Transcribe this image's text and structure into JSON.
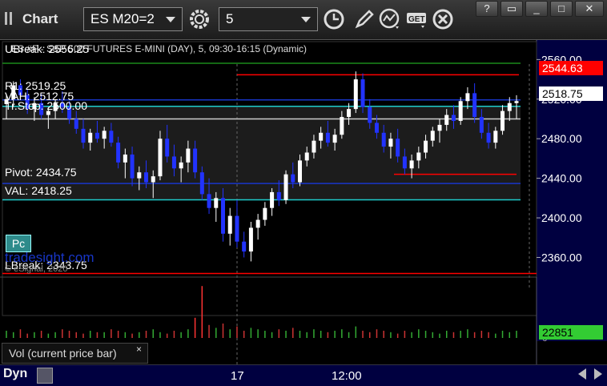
{
  "app": {
    "title": "Chart"
  },
  "toolbar": {
    "symbol": "ES M20=2",
    "interval": "5",
    "settings_icon": "gear-icon",
    "clock_icon": "clock-icon",
    "pen_icon": "pen-icon",
    "studies_icon": "studies-icon",
    "get_icon": "get-icon",
    "close_icon": "close-icon"
  },
  "window_buttons": [
    "?",
    "▭",
    "_",
    "□",
    "✕"
  ],
  "chart": {
    "header": "ES #F - S&P 500 FUTURES E-MINI (DAY), 5, 09:30-16:15 (Dynamic)",
    "levels": {
      "ubreak": "UBreak: 2556.25",
      "r1": "R1: 2519.25",
      "vah": "VAH: 2512.75",
      "trstop": "Tr.Stop: 2500.00",
      "pivot": "Pivot: 2434.75",
      "val": "VAL: 2418.25",
      "lbreak": "LBreak: 2343.75"
    },
    "pc_button": "Pc",
    "watermark": "tradesight.com",
    "copyright": "© eSignal, 2020",
    "price_axis": [
      "2560.00",
      "2520.00",
      "2480.00",
      "2440.00",
      "2400.00",
      "2360.00"
    ],
    "price_tags": {
      "red": "2544.63",
      "last": "2518.75"
    },
    "colors": {
      "up": "#ffffff",
      "down": "#2233ff",
      "ubreak": "#1a8a1a",
      "pivot": "#1836c8",
      "val": "#1ecbcb",
      "red": "#ff0000",
      "axis_bg": "#000040"
    }
  },
  "volume": {
    "label": "Vol (current price bar)",
    "close": "×",
    "value": "22851",
    "zero": "0"
  },
  "time_axis": {
    "labels": [
      "17",
      "12:00"
    ]
  },
  "footer": {
    "dyn": "Dyn"
  },
  "chart_data": {
    "type": "candlestick",
    "ylabel": "",
    "ylim": [
      2345,
      2570
    ],
    "series": [
      {
        "o": 2515,
        "h": 2525,
        "l": 2500,
        "c": 2520
      },
      {
        "o": 2520,
        "h": 2538,
        "l": 2512,
        "c": 2534
      },
      {
        "o": 2534,
        "h": 2540,
        "l": 2520,
        "c": 2524
      },
      {
        "o": 2524,
        "h": 2530,
        "l": 2505,
        "c": 2510
      },
      {
        "o": 2510,
        "h": 2522,
        "l": 2498,
        "c": 2516
      },
      {
        "o": 2516,
        "h": 2525,
        "l": 2500,
        "c": 2504
      },
      {
        "o": 2504,
        "h": 2512,
        "l": 2490,
        "c": 2508
      },
      {
        "o": 2508,
        "h": 2520,
        "l": 2500,
        "c": 2516
      },
      {
        "o": 2516,
        "h": 2528,
        "l": 2506,
        "c": 2512
      },
      {
        "o": 2512,
        "h": 2518,
        "l": 2495,
        "c": 2500
      },
      {
        "o": 2500,
        "h": 2508,
        "l": 2485,
        "c": 2490
      },
      {
        "o": 2490,
        "h": 2500,
        "l": 2470,
        "c": 2476
      },
      {
        "o": 2476,
        "h": 2490,
        "l": 2468,
        "c": 2486
      },
      {
        "o": 2486,
        "h": 2498,
        "l": 2476,
        "c": 2480
      },
      {
        "o": 2480,
        "h": 2492,
        "l": 2470,
        "c": 2488
      },
      {
        "o": 2488,
        "h": 2496,
        "l": 2472,
        "c": 2476
      },
      {
        "o": 2476,
        "h": 2482,
        "l": 2450,
        "c": 2456
      },
      {
        "o": 2456,
        "h": 2470,
        "l": 2440,
        "c": 2464
      },
      {
        "o": 2464,
        "h": 2472,
        "l": 2432,
        "c": 2440
      },
      {
        "o": 2440,
        "h": 2452,
        "l": 2428,
        "c": 2446
      },
      {
        "o": 2446,
        "h": 2458,
        "l": 2430,
        "c": 2436
      },
      {
        "o": 2436,
        "h": 2448,
        "l": 2420,
        "c": 2442
      },
      {
        "o": 2442,
        "h": 2488,
        "l": 2438,
        "c": 2480
      },
      {
        "o": 2480,
        "h": 2494,
        "l": 2456,
        "c": 2462
      },
      {
        "o": 2462,
        "h": 2474,
        "l": 2442,
        "c": 2450
      },
      {
        "o": 2450,
        "h": 2462,
        "l": 2436,
        "c": 2456
      },
      {
        "o": 2456,
        "h": 2478,
        "l": 2446,
        "c": 2470
      },
      {
        "o": 2470,
        "h": 2478,
        "l": 2440,
        "c": 2446
      },
      {
        "o": 2446,
        "h": 2452,
        "l": 2418,
        "c": 2424
      },
      {
        "o": 2424,
        "h": 2440,
        "l": 2404,
        "c": 2410
      },
      {
        "o": 2410,
        "h": 2426,
        "l": 2396,
        "c": 2420
      },
      {
        "o": 2420,
        "h": 2430,
        "l": 2376,
        "c": 2384
      },
      {
        "o": 2384,
        "h": 2410,
        "l": 2372,
        "c": 2402
      },
      {
        "o": 2402,
        "h": 2418,
        "l": 2370,
        "c": 2376
      },
      {
        "o": 2376,
        "h": 2386,
        "l": 2360,
        "c": 2366
      },
      {
        "o": 2366,
        "h": 2396,
        "l": 2356,
        "c": 2390
      },
      {
        "o": 2390,
        "h": 2404,
        "l": 2378,
        "c": 2398
      },
      {
        "o": 2398,
        "h": 2416,
        "l": 2392,
        "c": 2410
      },
      {
        "o": 2410,
        "h": 2430,
        "l": 2402,
        "c": 2426
      },
      {
        "o": 2426,
        "h": 2438,
        "l": 2412,
        "c": 2418
      },
      {
        "o": 2418,
        "h": 2448,
        "l": 2414,
        "c": 2444
      },
      {
        "o": 2444,
        "h": 2456,
        "l": 2430,
        "c": 2436
      },
      {
        "o": 2436,
        "h": 2464,
        "l": 2432,
        "c": 2458
      },
      {
        "o": 2458,
        "h": 2472,
        "l": 2452,
        "c": 2466
      },
      {
        "o": 2466,
        "h": 2484,
        "l": 2460,
        "c": 2478
      },
      {
        "o": 2478,
        "h": 2492,
        "l": 2470,
        "c": 2486
      },
      {
        "o": 2486,
        "h": 2498,
        "l": 2472,
        "c": 2476
      },
      {
        "o": 2476,
        "h": 2490,
        "l": 2468,
        "c": 2484
      },
      {
        "o": 2484,
        "h": 2508,
        "l": 2480,
        "c": 2502
      },
      {
        "o": 2502,
        "h": 2516,
        "l": 2494,
        "c": 2510
      },
      {
        "o": 2510,
        "h": 2548,
        "l": 2506,
        "c": 2540
      },
      {
        "o": 2540,
        "h": 2546,
        "l": 2506,
        "c": 2512
      },
      {
        "o": 2512,
        "h": 2520,
        "l": 2490,
        "c": 2496
      },
      {
        "o": 2496,
        "h": 2504,
        "l": 2480,
        "c": 2486
      },
      {
        "o": 2486,
        "h": 2494,
        "l": 2466,
        "c": 2472
      },
      {
        "o": 2472,
        "h": 2486,
        "l": 2460,
        "c": 2480
      },
      {
        "o": 2480,
        "h": 2490,
        "l": 2456,
        "c": 2462
      },
      {
        "o": 2462,
        "h": 2470,
        "l": 2444,
        "c": 2450
      },
      {
        "o": 2450,
        "h": 2464,
        "l": 2440,
        "c": 2458
      },
      {
        "o": 2458,
        "h": 2472,
        "l": 2450,
        "c": 2466
      },
      {
        "o": 2466,
        "h": 2484,
        "l": 2460,
        "c": 2478
      },
      {
        "o": 2478,
        "h": 2492,
        "l": 2472,
        "c": 2488
      },
      {
        "o": 2488,
        "h": 2500,
        "l": 2476,
        "c": 2494
      },
      {
        "o": 2494,
        "h": 2510,
        "l": 2488,
        "c": 2504
      },
      {
        "o": 2504,
        "h": 2514,
        "l": 2490,
        "c": 2498
      },
      {
        "o": 2498,
        "h": 2522,
        "l": 2494,
        "c": 2518
      },
      {
        "o": 2518,
        "h": 2532,
        "l": 2510,
        "c": 2526
      },
      {
        "o": 2526,
        "h": 2536,
        "l": 2496,
        "c": 2502
      },
      {
        "o": 2502,
        "h": 2510,
        "l": 2480,
        "c": 2486
      },
      {
        "o": 2486,
        "h": 2496,
        "l": 2470,
        "c": 2476
      },
      {
        "o": 2476,
        "h": 2492,
        "l": 2470,
        "c": 2488
      },
      {
        "o": 2488,
        "h": 2514,
        "l": 2484,
        "c": 2508
      },
      {
        "o": 2508,
        "h": 2522,
        "l": 2498,
        "c": 2516
      },
      {
        "o": 2516,
        "h": 2524,
        "l": 2500,
        "c": 2518
      }
    ],
    "volume": [
      5,
      4,
      6,
      3,
      4,
      5,
      3,
      4,
      6,
      5,
      4,
      3,
      5,
      4,
      4,
      6,
      5,
      4,
      3,
      4,
      5,
      6,
      4,
      3,
      5,
      4,
      6,
      14,
      36,
      9,
      7,
      10,
      6,
      8,
      5,
      7,
      6,
      5,
      4,
      6,
      5,
      7,
      5,
      4,
      6,
      5,
      4,
      5,
      6,
      4,
      8,
      5,
      4,
      6,
      5,
      4,
      3,
      5,
      4,
      6,
      5,
      4,
      3,
      5,
      4,
      5,
      6,
      4,
      5,
      4,
      3,
      5,
      4,
      5
    ]
  }
}
